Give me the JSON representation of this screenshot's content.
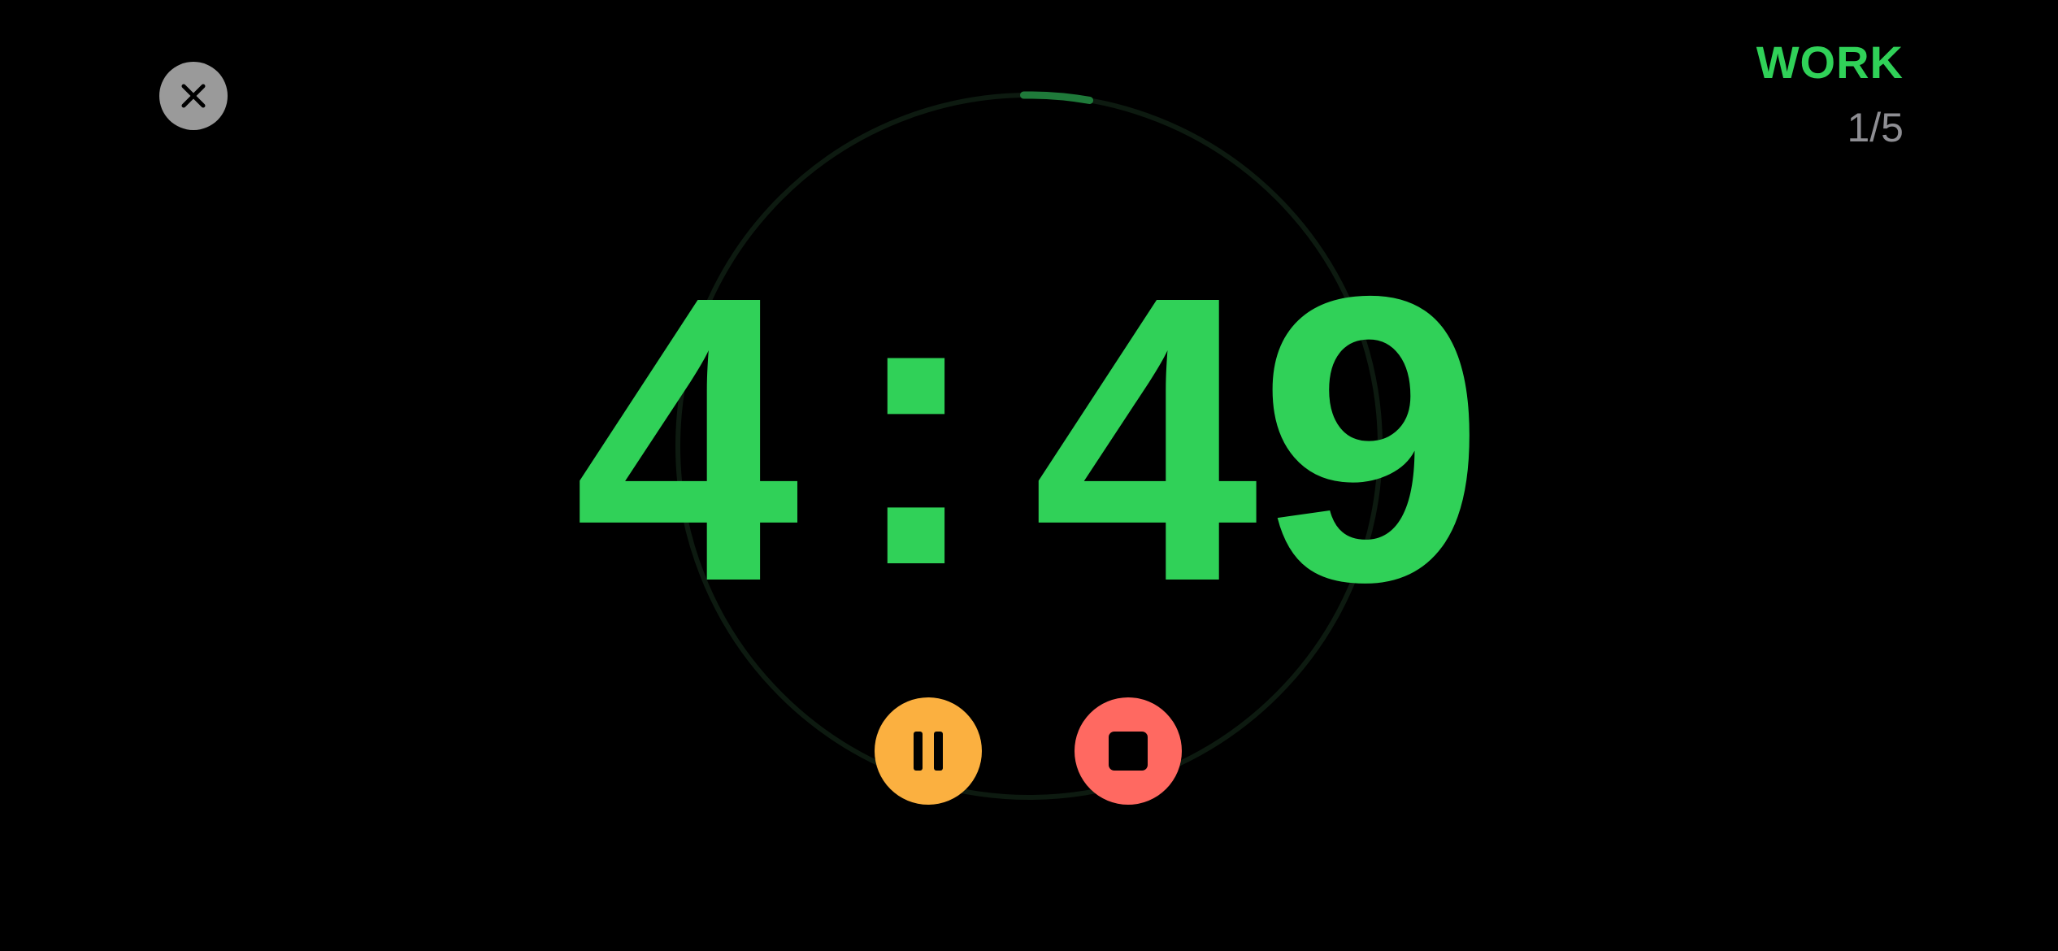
{
  "timer": {
    "phase": "WORK",
    "round": "1/5",
    "minutes": "4",
    "separator": ":",
    "seconds": "49",
    "progress_fraction": 0.03
  },
  "icons": {
    "close": "close-icon",
    "pause": "pause-icon",
    "stop": "stop-icon"
  },
  "colors": {
    "background": "#000000",
    "accent": "#30d158",
    "pause": "#fbb040",
    "stop": "#ff6961",
    "close": "#9a9a9a",
    "muted": "#8e8e93",
    "ring_track": "#0d1a10",
    "ring_progress": "#1f7a3a"
  }
}
